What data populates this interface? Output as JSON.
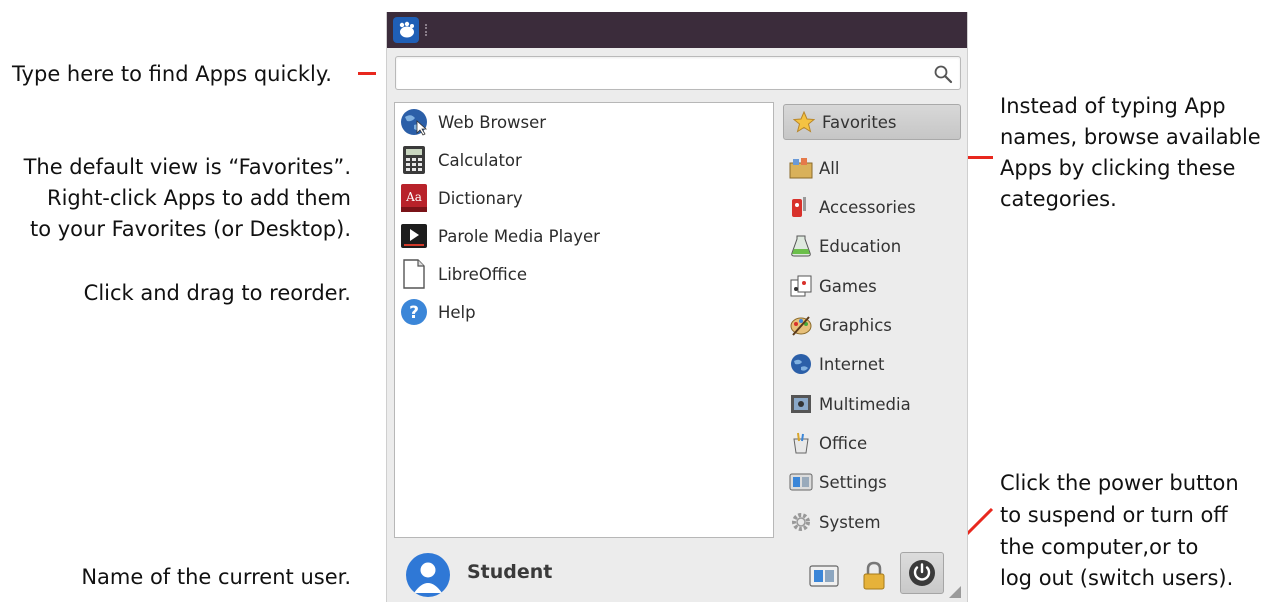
{
  "annotations": {
    "search_note": "Type here to find Apps quickly.",
    "favorites_note": [
      "The default view is “Favorites”.",
      "Right-click Apps to add them",
      "to your Favorites (or Desktop)."
    ],
    "reorder_note": "Click and drag to reorder.",
    "user_note": "Name of the current user.",
    "categories_note": [
      "Instead of typing App",
      "names, browse available",
      "Apps by clicking these",
      "categories."
    ],
    "power_note": [
      "Click the power button",
      "to suspend or turn off",
      "the computer,or to",
      "log out (switch users)."
    ]
  },
  "search": {
    "value": "",
    "placeholder": ""
  },
  "apps": [
    {
      "label": "Web Browser",
      "icon": "globe-icon"
    },
    {
      "label": "Calculator",
      "icon": "calculator-icon"
    },
    {
      "label": "Dictionary",
      "icon": "dictionary-icon"
    },
    {
      "label": "Parole Media Player",
      "icon": "media-player-icon"
    },
    {
      "label": "LibreOffice",
      "icon": "document-icon"
    },
    {
      "label": "Help",
      "icon": "help-icon"
    }
  ],
  "categories": [
    {
      "label": "Favorites",
      "icon": "star-icon",
      "selected": true
    },
    {
      "label": "All",
      "icon": "all-apps-icon"
    },
    {
      "label": "Accessories",
      "icon": "accessories-icon"
    },
    {
      "label": "Education",
      "icon": "education-icon"
    },
    {
      "label": "Games",
      "icon": "games-icon"
    },
    {
      "label": "Graphics",
      "icon": "graphics-icon"
    },
    {
      "label": "Internet",
      "icon": "internet-icon"
    },
    {
      "label": "Multimedia",
      "icon": "multimedia-icon"
    },
    {
      "label": "Office",
      "icon": "office-icon"
    },
    {
      "label": "Settings",
      "icon": "settings-icon"
    },
    {
      "label": "System",
      "icon": "system-icon"
    }
  ],
  "user": {
    "name": "Student"
  },
  "colors": {
    "accent_red": "#e8281e",
    "titlebar": "#3b2c3b",
    "xfce_blue": "#1f5fb6"
  }
}
